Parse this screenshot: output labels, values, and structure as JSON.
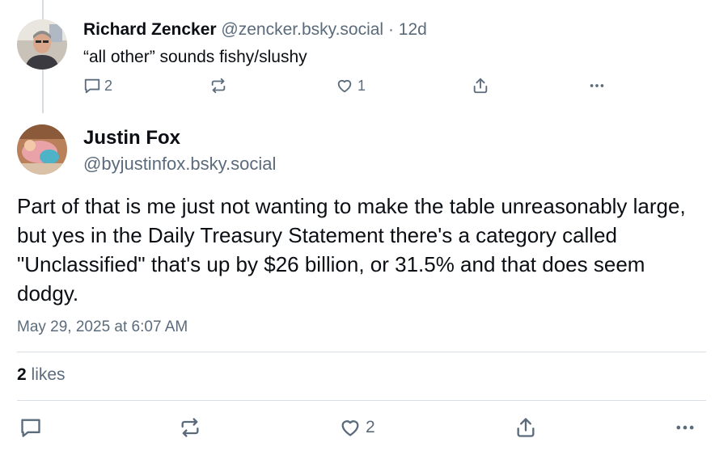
{
  "reply": {
    "author_name": "Richard Zencker",
    "author_handle": "@zencker.bsky.social",
    "separator": "·",
    "age": "12d",
    "text": "“all other” sounds fishy/slushy",
    "reply_count": "2",
    "like_count": "1"
  },
  "post": {
    "author_name": "Justin Fox",
    "author_handle": "@byjustinfox.bsky.social",
    "text": "Part of that is me just not wanting to make the table unreasonably large, but yes in the Daily Treasury Statement there's a category called \"Unclassified\" that's up by $26 billion, or 31.5% and that does seem dodgy.",
    "timestamp": "May 29, 2025 at 6:07 AM",
    "likes_count": "2",
    "likes_label": "likes",
    "like_count": "2"
  },
  "icons": {
    "reply": "comment-bubble-icon",
    "repost": "repost-arrows-icon",
    "like": "heart-icon",
    "share": "share-upload-icon",
    "more": "ellipsis-icon"
  },
  "colors": {
    "text_primary": "#0b0f14",
    "text_secondary": "#5b6b7c",
    "divider": "#d8dee4",
    "thread_line": "#d4dbe2"
  }
}
